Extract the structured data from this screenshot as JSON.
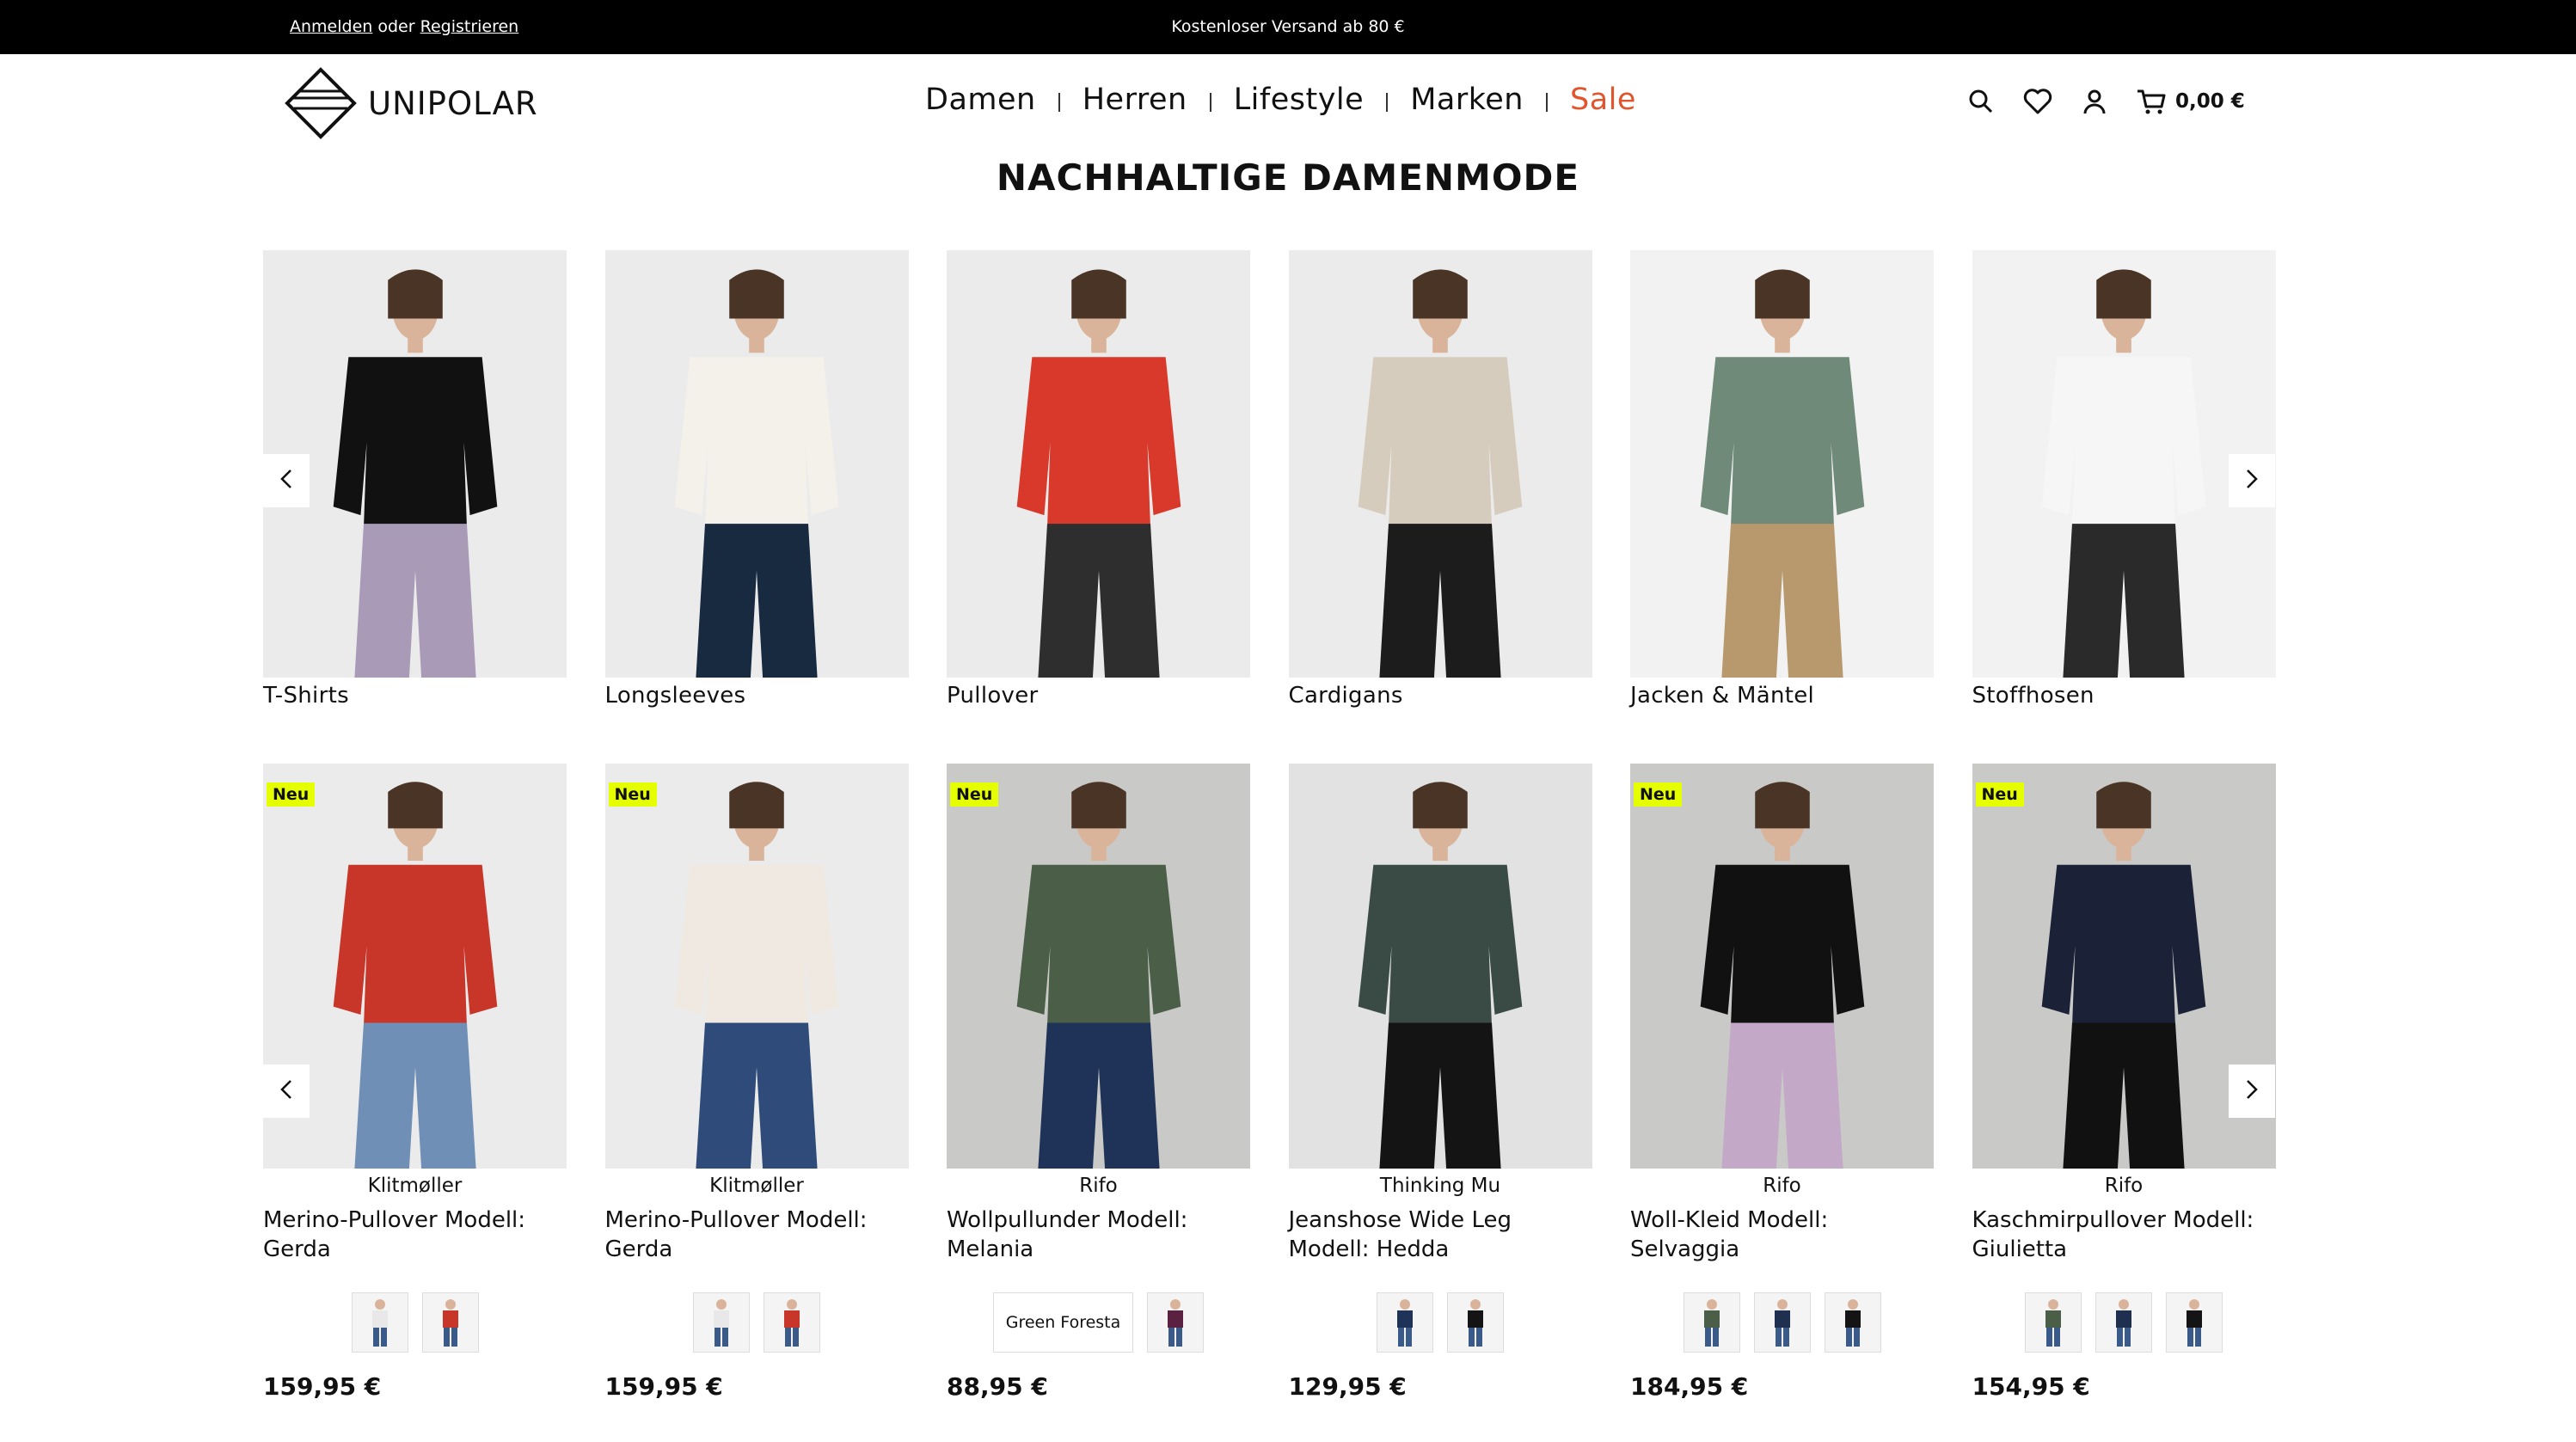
{
  "topbar": {
    "login": "Anmelden",
    "or": "oder",
    "register": "Registrieren",
    "shipping": "Kostenloser Versand ab 80 €"
  },
  "brand": {
    "name": "UNIPOLAR"
  },
  "nav": {
    "items": [
      {
        "label": "Damen"
      },
      {
        "label": "Herren"
      },
      {
        "label": "Lifestyle"
      },
      {
        "label": "Marken"
      },
      {
        "label": "Sale"
      }
    ],
    "sale_color": "#e0552d"
  },
  "tools": {
    "icons": [
      "search-icon",
      "heart-icon",
      "user-icon",
      "cart-icon"
    ],
    "cart_total": "0,00 €"
  },
  "page_title": "NACHHALTIGE DAMENMODE",
  "categories": [
    {
      "label": "T-Shirts",
      "top": "#111111",
      "bottom": "#a99bb8",
      "bg": "#ebebeb"
    },
    {
      "label": "Longsleeves",
      "top": "#f3f1ea",
      "bottom": "#182a40",
      "bg": "#ebebeb"
    },
    {
      "label": "Pullover",
      "top": "#d8392a",
      "bottom": "#2e2e2e",
      "bg": "#ebebeb"
    },
    {
      "label": "Cardigans",
      "top": "#d6ccbd",
      "bottom": "#1c1c1c",
      "bg": "#ebebeb"
    },
    {
      "label": "Jacken & Mäntel",
      "top": "#6f8a78",
      "bottom": "#b8996d",
      "bg": "#f2f2f2"
    },
    {
      "label": "Stoffhosen",
      "top": "#f6f6f6",
      "bottom": "#2a2a2a",
      "bg": "#f2f2f2"
    }
  ],
  "products": [
    {
      "badge": "Neu",
      "brand": "Klitmøller",
      "name": "Merino-Pullover Modell: Gerda",
      "price": "159,95 €",
      "top": "#c8362a",
      "bottom": "#6f8fb6",
      "bg": "#ebebeb",
      "swatches": [
        "#e8e8e8",
        "#c8362a"
      ]
    },
    {
      "badge": "Neu",
      "brand": "Klitmøller",
      "name": "Merino-Pullover Modell: Gerda",
      "price": "159,95 €",
      "top": "#efe9e1",
      "bottom": "#2f4b7a",
      "bg": "#ebebeb",
      "swatches": [
        "#e8e8e8",
        "#c8362a"
      ]
    },
    {
      "badge": "Neu",
      "brand": "Rifo",
      "name": "Wollpullunder Modell: Melania",
      "price": "88,95 €",
      "top": "#4b5e48",
      "bottom": "#1f3258",
      "bg": "#c9c9c7",
      "swatch_text": "Green Foresta",
      "swatches": [
        "#5a2240"
      ]
    },
    {
      "badge": "",
      "brand": "Thinking Mu",
      "name": "Jeanshose Wide Leg Modell: Hedda",
      "price": "129,95 €",
      "top": "#3a4a44",
      "bottom": "#141414",
      "bg": "#e2e2e2",
      "swatches": [
        "#1f3258",
        "#141414"
      ]
    },
    {
      "badge": "Neu",
      "brand": "Rifo",
      "name": "Woll-Kleid Modell: Selvaggia",
      "price": "184,95 €",
      "top": "#111111",
      "bottom": "#c3a8c8",
      "bg": "#c9c9c7",
      "swatches": [
        "#4b5e48",
        "#1f2f4f",
        "#141414"
      ]
    },
    {
      "badge": "Neu",
      "brand": "Rifo",
      "name": "Kaschmirpullover Modell: Giulietta",
      "price": "154,95 €",
      "top": "#1b2238",
      "bottom": "#111111",
      "bg": "#c9c9c7",
      "swatches": [
        "#4b5e48",
        "#1f2f4f",
        "#141414"
      ]
    }
  ]
}
